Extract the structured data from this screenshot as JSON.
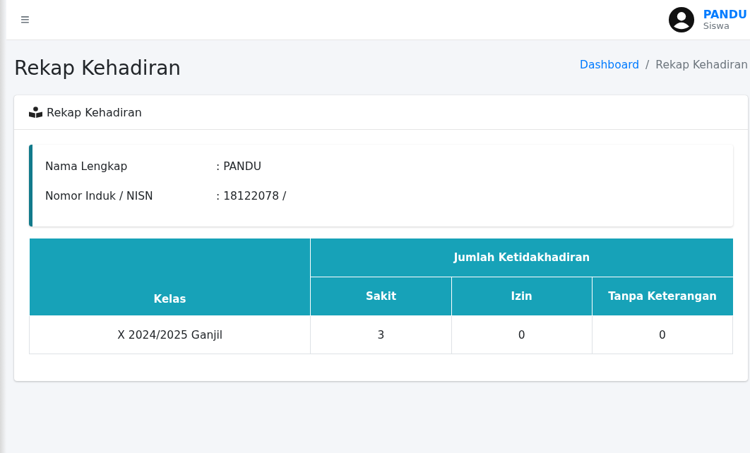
{
  "navbar": {
    "menu_icon": "≡",
    "user": {
      "name": "PANDU",
      "role": "Siswa"
    }
  },
  "page_title": "Rekap Kehadiran",
  "breadcrumb": [
    {
      "label": "Dashboard",
      "link": true
    },
    {
      "label": "/",
      "link": false
    },
    {
      "label": "Rekap Kehadiran",
      "link": false
    }
  ],
  "card": {
    "title": "Rekap Kehadiran",
    "info": [
      {
        "label": "Nama Lengkap",
        "value": ": PANDU"
      },
      {
        "label": "Nomor Induk / NISN",
        "value": ": 18122078 /"
      }
    ],
    "table": {
      "column_1": "Kelas",
      "group_heading": "Jumlah Ketidakhadiran",
      "subcolumns": [
        "Sakit",
        "Izin",
        "Tanpa Keterangan"
      ],
      "rows": [
        [
          "X 2024/2025 Ganjil",
          "3",
          "0",
          "0"
        ]
      ]
    }
  }
}
